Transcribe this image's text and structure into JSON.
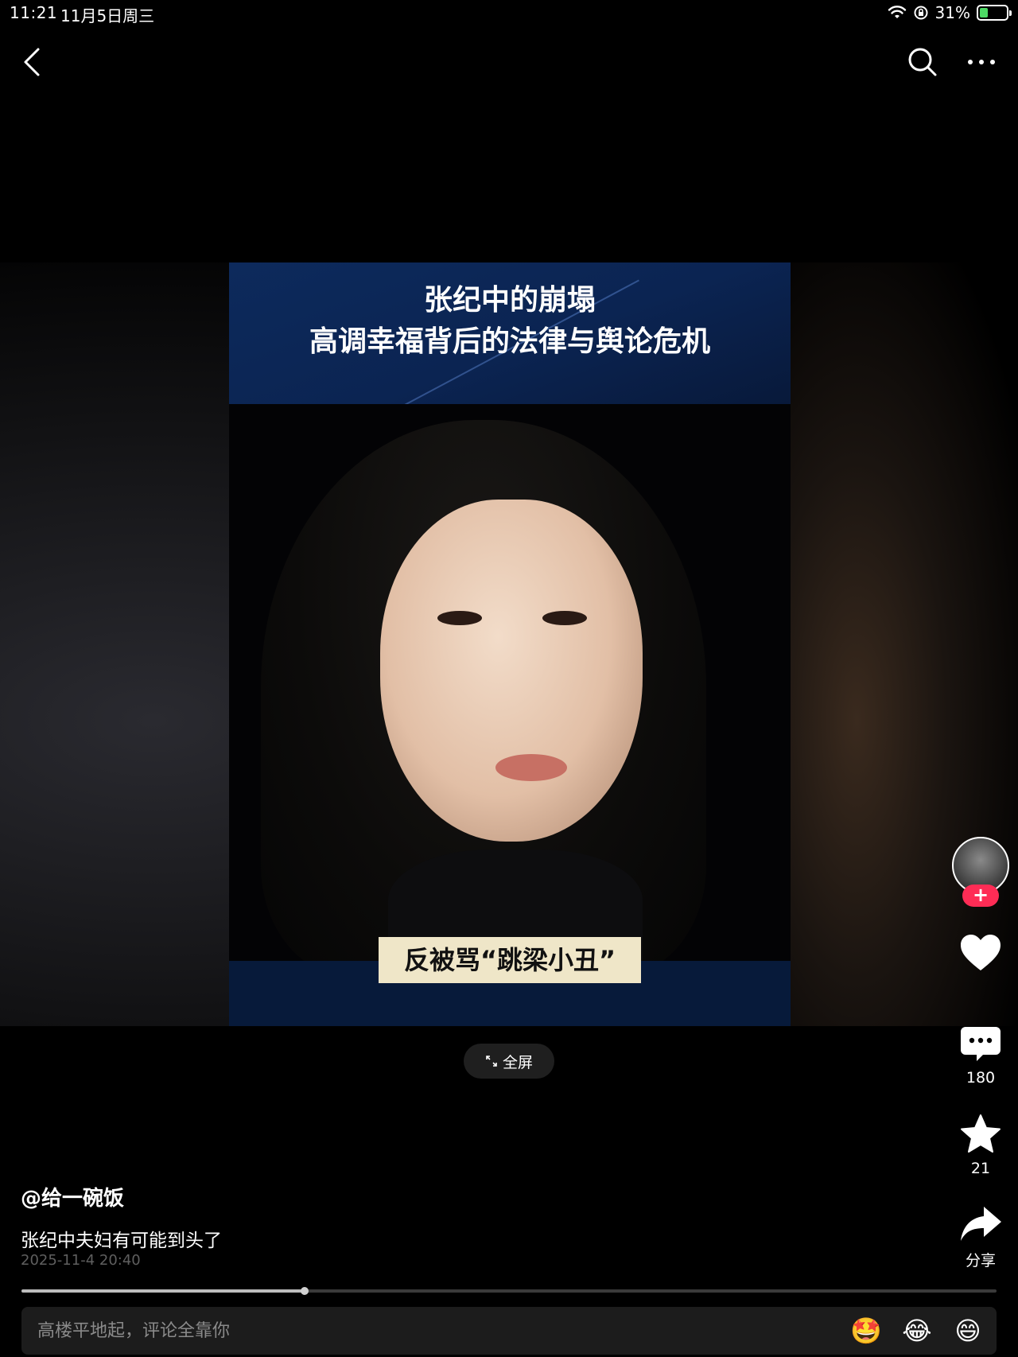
{
  "status_bar": {
    "time": "11:21",
    "date": "11月5日周三",
    "battery": "31%",
    "battery_level": 0.31
  },
  "video": {
    "headline_1": "张纪中的崩塌",
    "headline_2": "高调幸福背后的法律与舆论危机",
    "caption": "反被骂“跳梁小丑”",
    "fullscreen_label": "全屏",
    "progress": 0.29
  },
  "rail": {
    "comments_count": "180",
    "favorites_count": "21",
    "share_label": "分享"
  },
  "post": {
    "author": "@给一碗饭",
    "description": "张纪中夫妇有可能到头了",
    "timestamp": "2025-11-4 20:40"
  },
  "comment_bar": {
    "placeholder": "高楼平地起，评论全靠你",
    "emojis": [
      "🤩",
      "😂",
      "😄"
    ]
  },
  "colors": {
    "accent": "#fe2c55",
    "battery": "#4cd964"
  }
}
